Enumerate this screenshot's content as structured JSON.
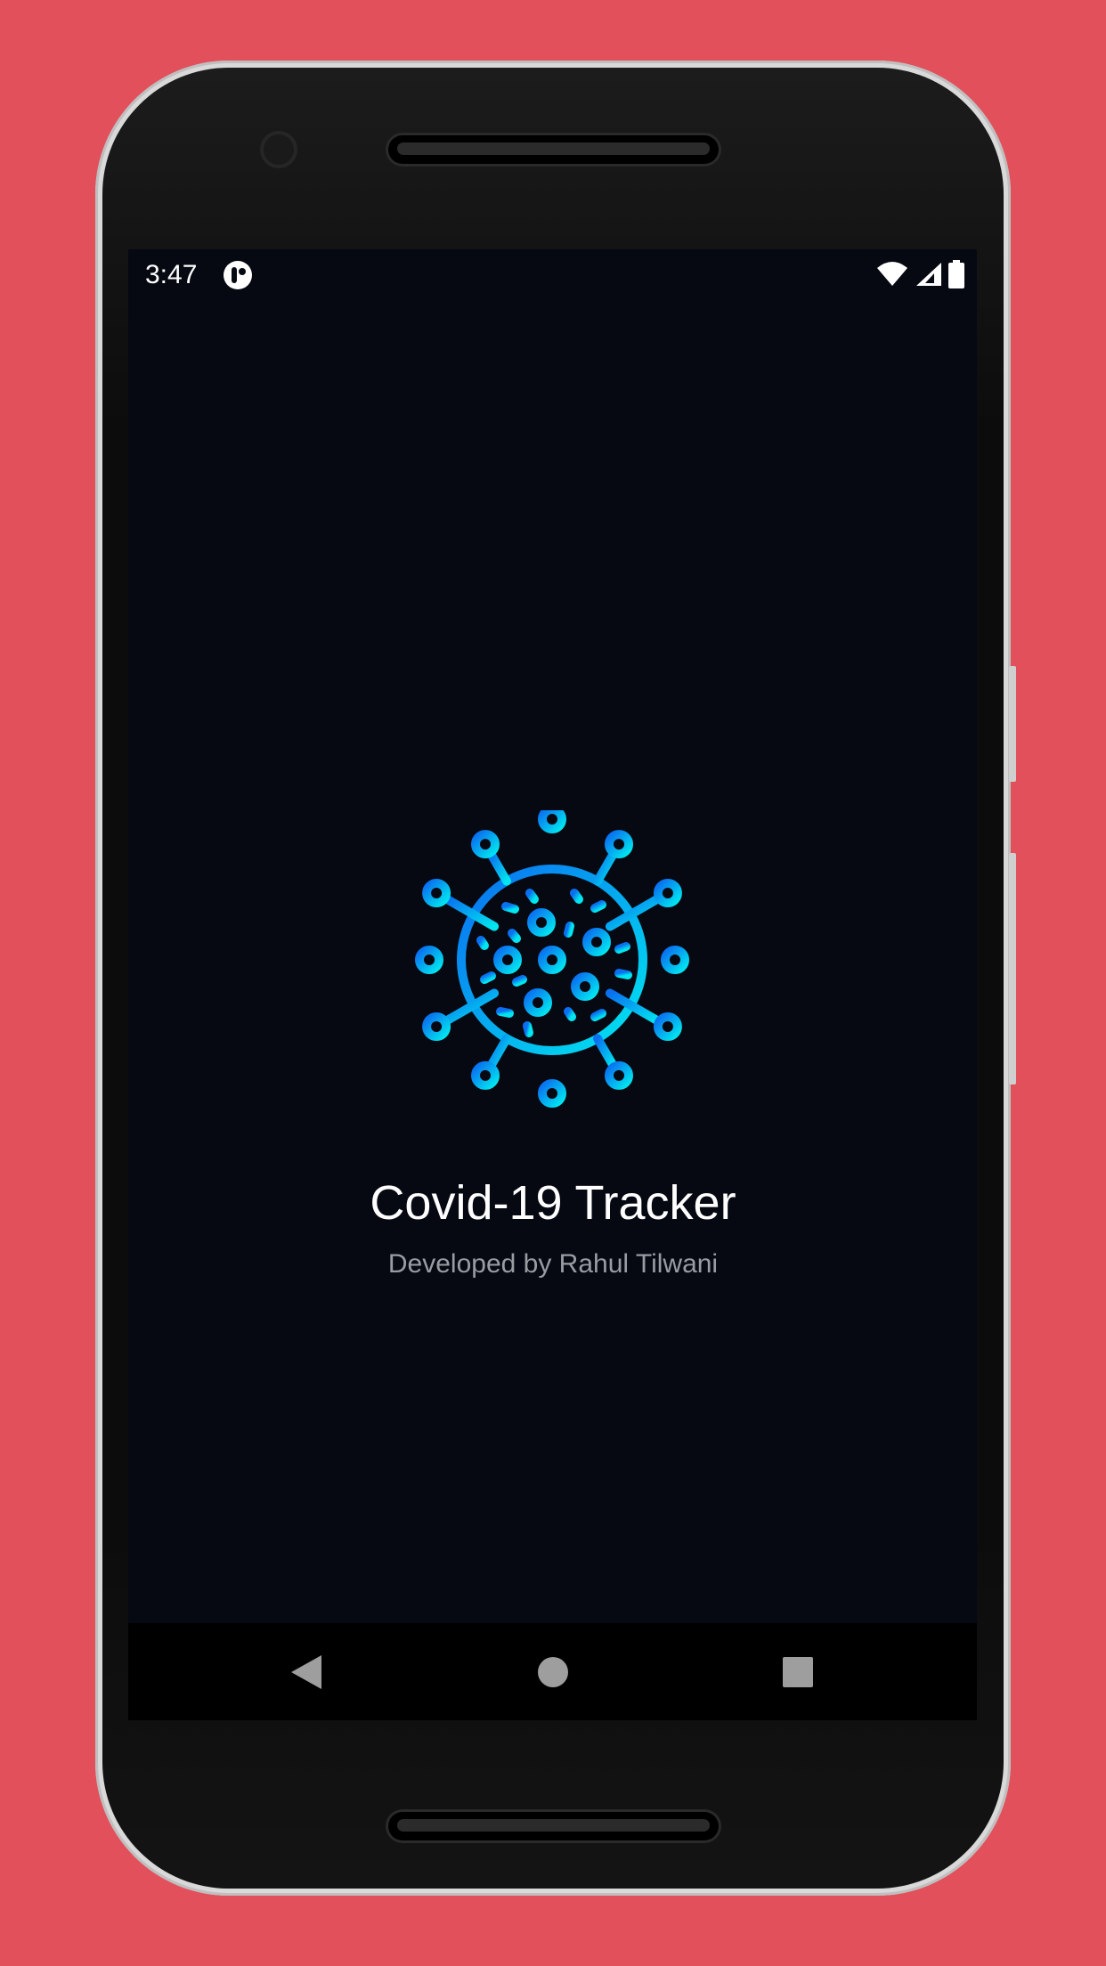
{
  "status_bar": {
    "time": "3:47",
    "icons": [
      "app-notification-icon",
      "wifi-icon",
      "signal-icon",
      "battery-icon"
    ]
  },
  "splash": {
    "title": "Covid-19 Tracker",
    "subtitle": "Developed by Rahul Tilwani",
    "logo_icon": "virus-icon",
    "gradient": {
      "start": "#0a6ff0",
      "end": "#00e6f0"
    }
  },
  "nav_bar": {
    "back": "back-icon",
    "home": "home-icon",
    "recents": "recents-icon"
  },
  "colors": {
    "background": "#e2505b",
    "screen": "#060912"
  }
}
